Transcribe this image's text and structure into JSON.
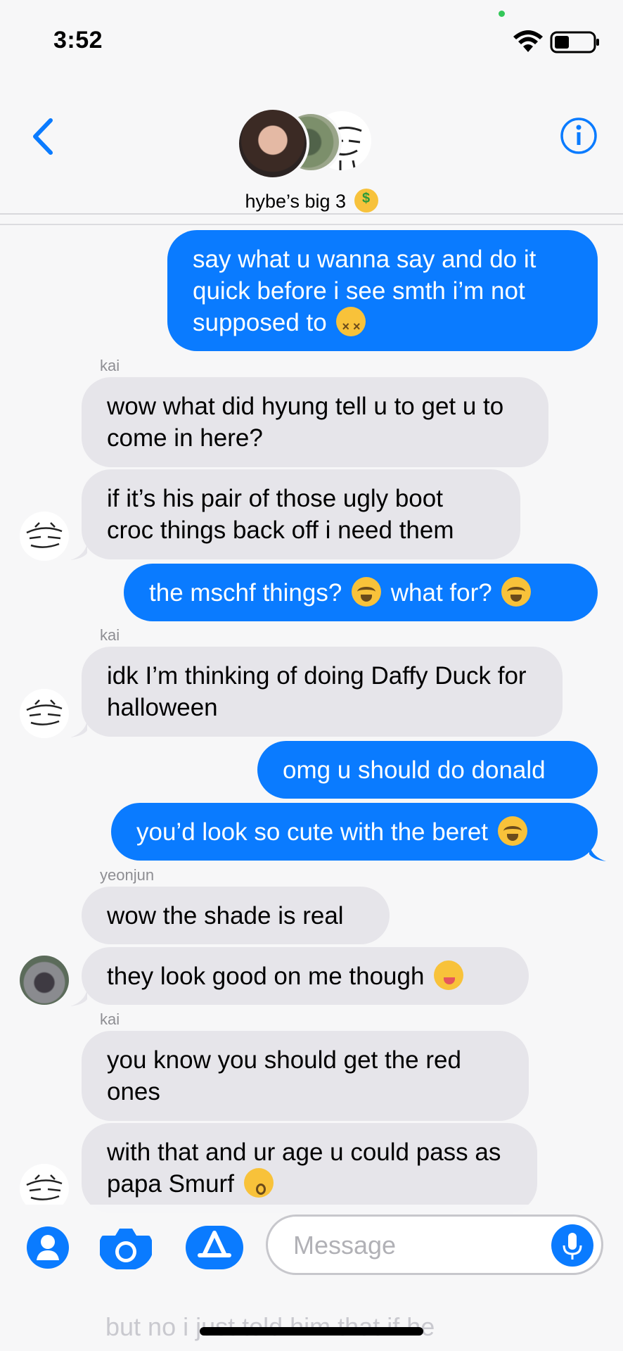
{
  "status_bar": {
    "time": "3:52"
  },
  "header": {
    "group_name": "hybe’s big 3",
    "group_emoji": "money-mouth-face"
  },
  "messages": [
    {
      "side": "sent",
      "text": "say what u wanna say and do it quick before i see smth i’m not supposed to",
      "emoji": "confounded-face"
    },
    {
      "side": "recv",
      "sender": "kai",
      "text": "wow what did hyung tell u to get u to come in here?"
    },
    {
      "side": "recv",
      "text": "if it’s his pair of those ugly boot croc things back off i need them"
    },
    {
      "side": "sent",
      "text_a": "the mschf things?",
      "text_b": "what for?",
      "emoji": "loudly-crying-face"
    },
    {
      "side": "recv",
      "sender": "kai",
      "text": "idk I’m thinking of doing Daffy Duck for halloween"
    },
    {
      "side": "sent",
      "text": "omg u should do donald"
    },
    {
      "side": "sent",
      "text": "you’d look so cute with the beret",
      "emoji": "loudly-crying-face"
    },
    {
      "side": "recv",
      "sender": "yeonjun",
      "text": "wow the shade is real"
    },
    {
      "side": "recv",
      "text": "they look good on me though",
      "emoji": "face-savoring-food"
    },
    {
      "side": "recv",
      "sender": "kai",
      "text": "you know you should get the red ones"
    },
    {
      "side": "recv",
      "text": "with that and ur age u could pass as papa Smurf",
      "emoji": "kissing-face"
    }
  ],
  "input": {
    "placeholder": "Message",
    "ghost_text": "but no i just told him that if he"
  },
  "colors": {
    "sent_bubble": "#0a7bff",
    "recv_bubble": "#e6e5ea",
    "accent": "#0a7bff"
  }
}
